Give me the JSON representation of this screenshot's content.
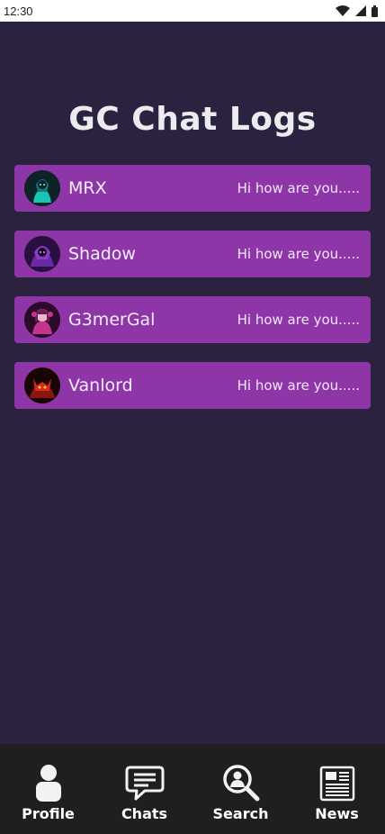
{
  "status_bar": {
    "time": "12:30",
    "icons": [
      "wifi-icon",
      "cellular-signal-icon",
      "battery-icon"
    ]
  },
  "page": {
    "title": "GC Chat Logs",
    "background": "#2b2240",
    "accent": "#8e36a8"
  },
  "chats": [
    {
      "name": "MRX",
      "preview": "Hi how are you.....",
      "avatar": "mrx-avatar",
      "avatar_color": "#19c4b4"
    },
    {
      "name": "Shadow",
      "preview": "Hi how are you.....",
      "avatar": "shadow-avatar",
      "avatar_color": "#8a3cc8"
    },
    {
      "name": "G3merGal",
      "preview": "Hi how are you.....",
      "avatar": "g3mergal-avatar",
      "avatar_color": "#c2348e"
    },
    {
      "name": "Vanlord",
      "preview": "Hi how are you.....",
      "avatar": "vanlord-avatar",
      "avatar_color": "#d42a20"
    }
  ],
  "nav": [
    {
      "label": "Profile",
      "icon": "profile-icon"
    },
    {
      "label": "Chats",
      "icon": "chat-bubble-icon"
    },
    {
      "label": "Search",
      "icon": "search-user-icon"
    },
    {
      "label": "News",
      "icon": "newspaper-icon"
    }
  ]
}
